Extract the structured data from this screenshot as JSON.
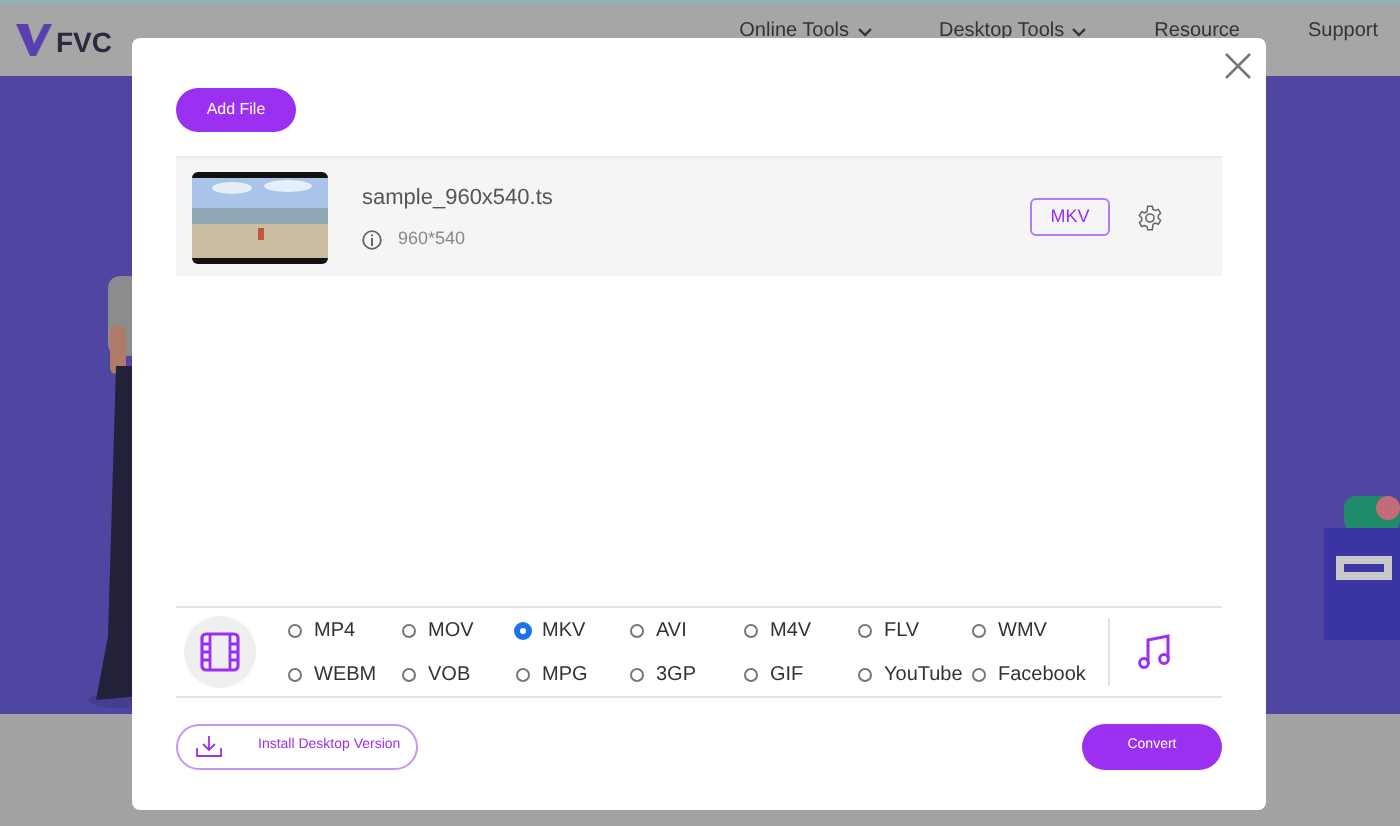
{
  "header": {
    "logo": "FVC",
    "nav": [
      {
        "label": "Online Tools",
        "dropdown": true
      },
      {
        "label": "Desktop Tools",
        "dropdown": true
      },
      {
        "label": "Resource",
        "dropdown": false
      },
      {
        "label": "Support",
        "dropdown": false
      }
    ]
  },
  "dialog": {
    "add_button": "Add File",
    "file": {
      "name": "sample_960x540.ts",
      "resolution": "960*540",
      "format": "MKV"
    },
    "formats": [
      {
        "label": "MP4",
        "selected": false
      },
      {
        "label": "MOV",
        "selected": false
      },
      {
        "label": "MKV",
        "selected": true
      },
      {
        "label": "AVI",
        "selected": false
      },
      {
        "label": "M4V",
        "selected": false
      },
      {
        "label": "FLV",
        "selected": false
      },
      {
        "label": "WMV",
        "selected": false
      },
      {
        "label": "WEBM",
        "selected": false
      },
      {
        "label": "VOB",
        "selected": false
      },
      {
        "label": "MPG",
        "selected": false
      },
      {
        "label": "3GP",
        "selected": false
      },
      {
        "label": "GIF",
        "selected": false
      },
      {
        "label": "YouTube",
        "selected": false
      },
      {
        "label": "Facebook",
        "selected": false
      }
    ],
    "install_button": "Install Desktop Version",
    "convert_button": "Convert"
  }
}
